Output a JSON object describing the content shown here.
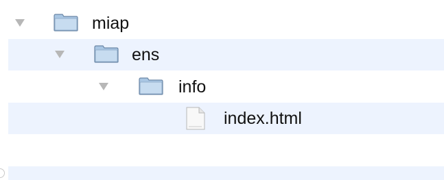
{
  "tree": {
    "items": [
      {
        "label": "miap",
        "kind": "folder",
        "expanded": true,
        "depth": 0
      },
      {
        "label": "ens",
        "kind": "folder",
        "expanded": true,
        "depth": 1
      },
      {
        "label": "info",
        "kind": "folder",
        "expanded": true,
        "depth": 2
      },
      {
        "label": "index.html",
        "kind": "file",
        "expanded": false,
        "depth": 3
      }
    ]
  },
  "colors": {
    "row_alt": "#edf3fe",
    "disclosure": "#b7b7b7",
    "folder_body": "#a9c6e3",
    "folder_edge": "#6b87a6",
    "text": "#111111"
  },
  "icons": {
    "disclosure": "disclosure-triangle-icon",
    "folder": "folder-icon",
    "file": "html-file-icon"
  }
}
